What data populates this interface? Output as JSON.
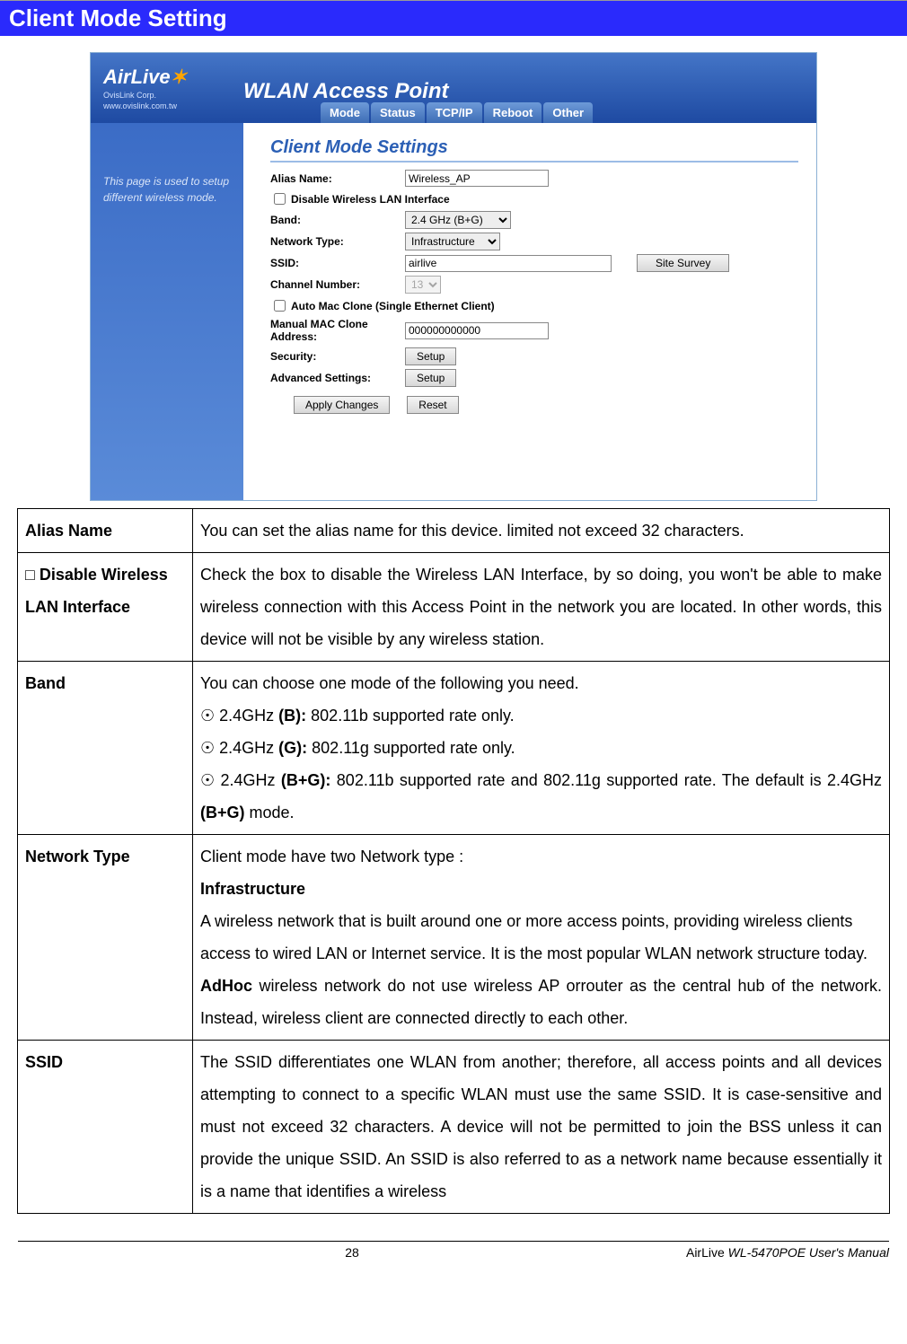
{
  "page_title": "Client Mode Setting",
  "app": {
    "logo_line1": "AirLive",
    "logo_sub1": "OvisLink Corp.",
    "logo_sub2": "www.ovislink.com.tw",
    "header_title": "WLAN Access Point",
    "tabs": [
      "Mode",
      "Status",
      "TCP/IP",
      "Reboot",
      "Other"
    ],
    "sidebar_text": "This page is used to setup different wireless mode.",
    "section_heading": "Client Mode Settings",
    "form": {
      "alias_label": "Alias Name:",
      "alias_value": "Wireless_AP",
      "disable_wlan_label": "Disable Wireless LAN Interface",
      "band_label": "Band:",
      "band_value": "2.4 GHz (B+G)",
      "nettype_label": "Network Type:",
      "nettype_value": "Infrastructure",
      "ssid_label": "SSID:",
      "ssid_value": "airlive",
      "site_survey_btn": "Site Survey",
      "channel_label": "Channel Number:",
      "channel_value": "13",
      "automac_label": "Auto Mac Clone (Single Ethernet Client)",
      "macclone_label": "Manual MAC Clone Address:",
      "macclone_value": "000000000000",
      "security_label": "Security:",
      "advanced_label": "Advanced Settings:",
      "setup_btn": "Setup",
      "apply_btn": "Apply Changes",
      "reset_btn": "Reset"
    }
  },
  "desc": {
    "r1_label": "Alias Name",
    "r1_text": "You can set the alias name for this device. limited not exceed 32 characters.",
    "r2_label_prefix": "□ ",
    "r2_label": "Disable Wireless LAN Interface",
    "r2_text": "Check the box to disable the Wireless LAN Interface, by so doing, you won't be able to make wireless connection with this Access Point in the network you are located. In other words, this device will not be visible by any wireless station.",
    "r3_label": "Band",
    "r3_line1": "You can choose one mode of the following you need.",
    "r3_b1a": "☉ 2.4GHz ",
    "r3_b1b": "(B):",
    "r3_b1c": " 802.11b supported rate only.",
    "r3_b2a": "☉ 2.4GHz ",
    "r3_b2b": "(G):",
    "r3_b2c": " 802.11g supported rate only.",
    "r3_b3a": "☉ 2.4GHz ",
    "r3_b3b": "(B+G):",
    "r3_b3c": " 802.11b supported rate and 802.11g supported rate. The default is 2.4GHz ",
    "r3_b3d": "(B+G)",
    "r3_b3e": " mode.",
    "r4_label": "Network Type",
    "r4_line1": "Client mode have two Network type :",
    "r4_infra_h": "Infrastructure",
    "r4_infra_t": "A wireless network that is built around one or more access points, providing wireless clients access to wired LAN or Internet service. It is the most popular WLAN network structure today.",
    "r4_adhoc_h": "AdHoc",
    "r4_adhoc_t": " wireless network do not use wireless AP orrouter as the central hub of the network. Instead, wireless client are connected directly to each other.",
    "r5_label": "SSID",
    "r5_text": "The SSID differentiates one WLAN from another; therefore, all access points and all devices attempting to connect to a specific WLAN must use the same SSID. It is case-sensitive and must not exceed 32 characters.   A device will not be permitted to join the BSS unless it can provide the unique SSID. An SSID is also referred to as a network name because essentially it is a name that identifies a wireless"
  },
  "footer": {
    "page_number": "28",
    "brand": "AirLive ",
    "model": "WL-5470POE User's Manual"
  }
}
